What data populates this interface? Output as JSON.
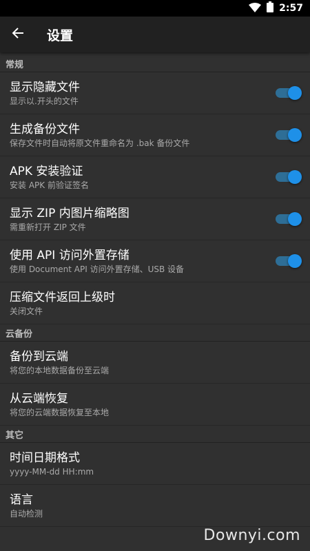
{
  "status": {
    "time": "2:57"
  },
  "appbar": {
    "title": "设置"
  },
  "sections": {
    "general": {
      "header": "常规",
      "items": [
        {
          "title": "显示隐藏文件",
          "subtitle": "显示以.开头的文件",
          "toggle": true
        },
        {
          "title": "生成备份文件",
          "subtitle": "保存文件时自动将原文件重命名为 .bak 备份文件",
          "toggle": true
        },
        {
          "title": "APK 安装验证",
          "subtitle": "安装 APK 前验证签名",
          "toggle": true
        },
        {
          "title": "显示 ZIP 内图片缩略图",
          "subtitle": "需重新打开 ZIP 文件",
          "toggle": true
        },
        {
          "title": "使用 API 访问外置存储",
          "subtitle": "使用 Document API 访问外置存储、USB 设备",
          "toggle": true
        },
        {
          "title": "压缩文件返回上级时",
          "subtitle": "关闭文件"
        }
      ]
    },
    "cloud": {
      "header": "云备份",
      "items": [
        {
          "title": "备份到云端",
          "subtitle": "将您的本地数据备份至云端"
        },
        {
          "title": "从云端恢复",
          "subtitle": "将您的云端数据恢复至本地"
        }
      ]
    },
    "other": {
      "header": "其它",
      "items": [
        {
          "title": "时间日期格式",
          "subtitle": "yyyy-MM-dd HH:mm"
        },
        {
          "title": "语言",
          "subtitle": "自动检测"
        }
      ]
    }
  },
  "watermark": "Downyi.com",
  "colors": {
    "accent": "#1e90e8",
    "track": "#2e6e96",
    "background": "#303030",
    "appbar": "#212121"
  }
}
